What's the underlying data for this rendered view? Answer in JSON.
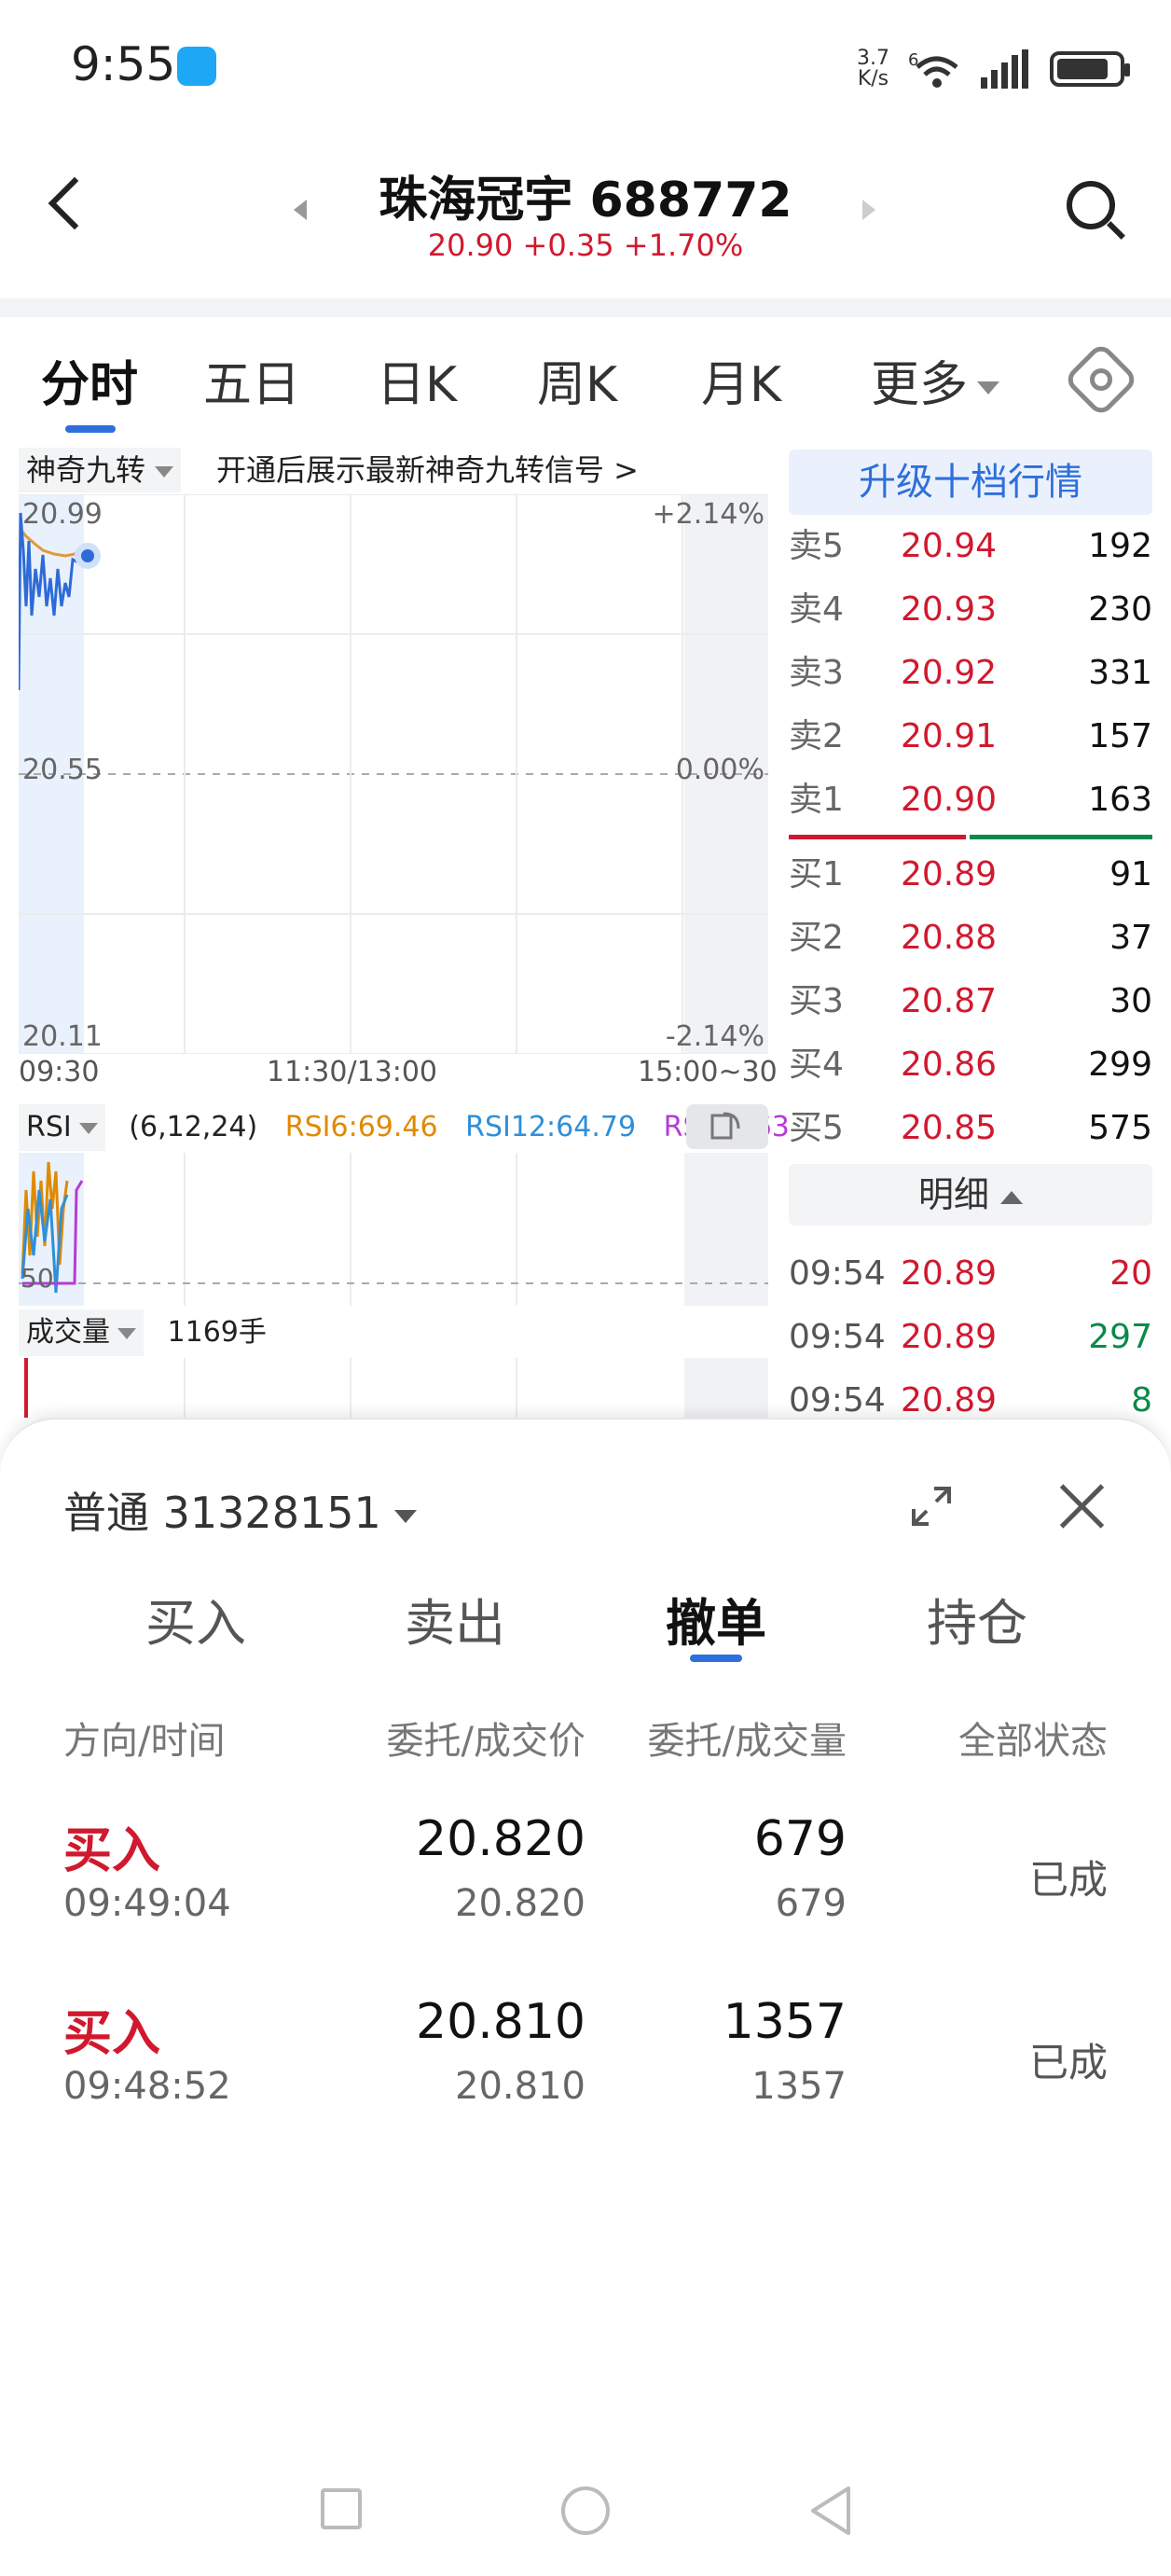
{
  "status_bar": {
    "time": "9:55",
    "speed_value": "3.7",
    "speed_unit": "K/s",
    "network": "6"
  },
  "header": {
    "title": "珠海冠宇 688772",
    "quote": "20.90 +0.35 +1.70%"
  },
  "tabs": [
    {
      "label": "分时",
      "active": true
    },
    {
      "label": "五日"
    },
    {
      "label": "日K"
    },
    {
      "label": "周K"
    },
    {
      "label": "月K"
    },
    {
      "label": "更多"
    }
  ],
  "nine_turn": {
    "label": "神奇九转",
    "hint": "开通后展示最新神奇九转信号 >"
  },
  "chart": {
    "price_high": "20.99",
    "price_mid": "20.55",
    "price_low": "20.11",
    "pct_high": "+2.14%",
    "pct_mid": "0.00%",
    "pct_low": "-2.14%",
    "time_start": "09:30",
    "time_mid": "11:30/13:00",
    "time_end": "15:00~30"
  },
  "rsi": {
    "label": "RSI",
    "params": "(6,12,24)",
    "rsi6": "RSI6:69.46",
    "rsi12": "RSI12:64.79",
    "rsi24": "RSI24:63",
    "level_label": "50",
    "colors": {
      "rsi6": "#e08a00",
      "rsi12": "#2f8fd8",
      "rsi24": "#b53cd6"
    }
  },
  "volume": {
    "label": "成交量",
    "value": "1169手"
  },
  "order_book": {
    "upgrade_label": "升级十档行情",
    "asks": [
      {
        "label": "卖5",
        "price": "20.94",
        "volume": "192"
      },
      {
        "label": "卖4",
        "price": "20.93",
        "volume": "230"
      },
      {
        "label": "卖3",
        "price": "20.92",
        "volume": "331"
      },
      {
        "label": "卖2",
        "price": "20.91",
        "volume": "157"
      },
      {
        "label": "卖1",
        "price": "20.90",
        "volume": "163"
      }
    ],
    "bids": [
      {
        "label": "买1",
        "price": "20.89",
        "volume": "91"
      },
      {
        "label": "买2",
        "price": "20.88",
        "volume": "37"
      },
      {
        "label": "买3",
        "price": "20.87",
        "volume": "30"
      },
      {
        "label": "买4",
        "price": "20.86",
        "volume": "299"
      },
      {
        "label": "买5",
        "price": "20.85",
        "volume": "575"
      }
    ],
    "detail_label": "明细",
    "ticks": [
      {
        "time": "09:54",
        "price": "20.89",
        "volume": "20",
        "side": "buy"
      },
      {
        "time": "09:54",
        "price": "20.89",
        "volume": "297",
        "side": "sell"
      },
      {
        "time": "09:54",
        "price": "20.89",
        "volume": "8",
        "side": "sell"
      }
    ]
  },
  "sheet": {
    "account": "普通 31328151",
    "tabs": [
      {
        "label": "买入"
      },
      {
        "label": "卖出"
      },
      {
        "label": "撤单",
        "active": true
      },
      {
        "label": "持仓"
      }
    ],
    "columns": [
      "方向/时间",
      "委托/成交价",
      "委托/成交量",
      "全部状态"
    ],
    "orders": [
      {
        "direction": "买入",
        "time": "09:49:04",
        "price": "20.820",
        "deal_price": "20.820",
        "qty": "679",
        "deal_qty": "679",
        "status": "已成"
      },
      {
        "direction": "买入",
        "time": "09:48:52",
        "price": "20.810",
        "deal_price": "20.810",
        "qty": "1357",
        "deal_qty": "1357",
        "status": "已成"
      }
    ]
  },
  "colors": {
    "up": "#d0192e",
    "down": "#0a8a4a",
    "accent": "#2f6fdc"
  }
}
